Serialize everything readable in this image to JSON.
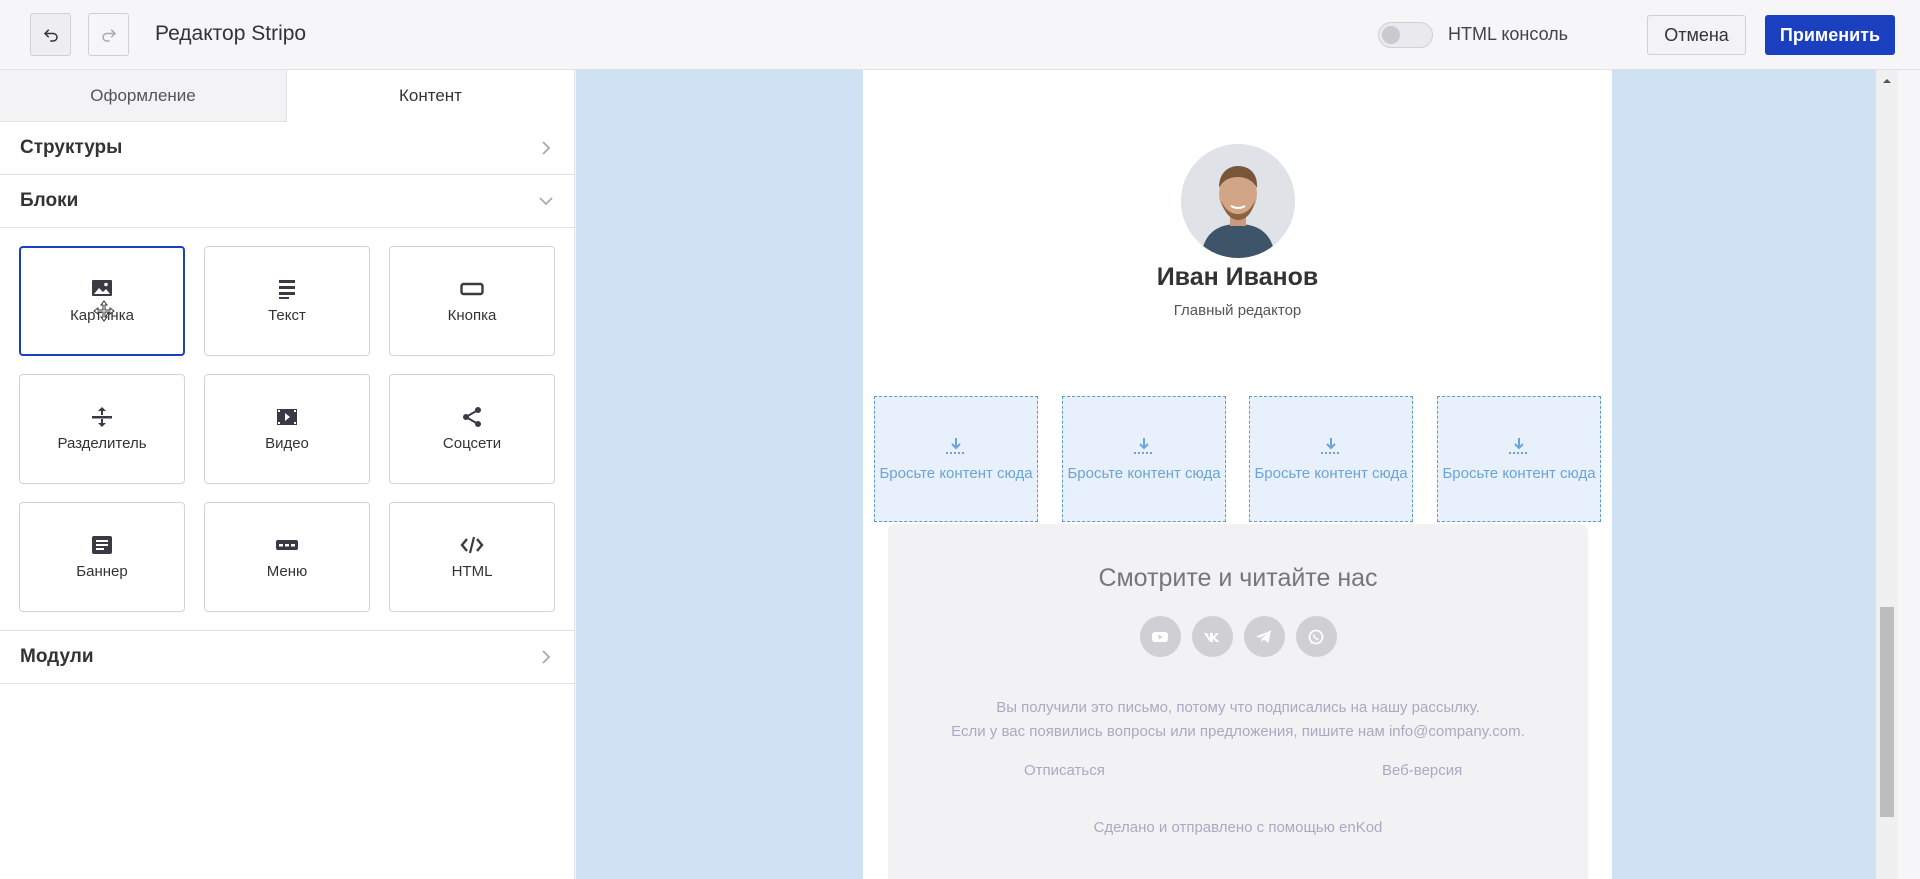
{
  "header": {
    "title": "Редактор Stripo",
    "html_console_label": "HTML консоль",
    "cancel_label": "Отмена",
    "apply_label": "Применить"
  },
  "panel": {
    "tabs": [
      {
        "label": "Оформление"
      },
      {
        "label": "Контент"
      }
    ],
    "sections": {
      "structures": "Структуры",
      "blocks": "Блоки",
      "modules": "Модули"
    },
    "blocks": [
      {
        "label": "Картинка",
        "icon": "image-icon"
      },
      {
        "label": "Текст",
        "icon": "text-icon"
      },
      {
        "label": "Кнопка",
        "icon": "button-icon"
      },
      {
        "label": "Разделитель",
        "icon": "spacer-icon"
      },
      {
        "label": "Видео",
        "icon": "video-icon"
      },
      {
        "label": "Соцсети",
        "icon": "share-icon"
      },
      {
        "label": "Баннер",
        "icon": "banner-icon"
      },
      {
        "label": "Меню",
        "icon": "menu-icon"
      },
      {
        "label": "HTML",
        "icon": "code-icon"
      }
    ]
  },
  "email": {
    "name": "Иван Иванов",
    "role": "Главный редактор",
    "dropzones": [
      {
        "text": "Бросьте контент сюда"
      },
      {
        "text": "Бросьте контент сюда"
      },
      {
        "text": "Бросьте контент сюда"
      },
      {
        "text": "Бросьте контент сюда"
      }
    ],
    "footer": {
      "title": "Смотрите и читайте нас",
      "socials": [
        "youtube-icon",
        "vk-icon",
        "telegram-icon",
        "whatsapp-icon"
      ],
      "note_line1": "Вы получили это письмо, потому что подписались на нашу рассылку.",
      "note_line2": "Если у вас появились вопросы или предложения, пишите нам info@company.com.",
      "unsubscribe": "Отписаться",
      "web_version": "Веб-версия",
      "made_with": "Сделано и отправлено с помощью enKod"
    }
  },
  "colors": {
    "accent": "#1a3fbf",
    "canvas_bg": "#cfe2f3",
    "dropzone_border": "#5b9bd5"
  }
}
